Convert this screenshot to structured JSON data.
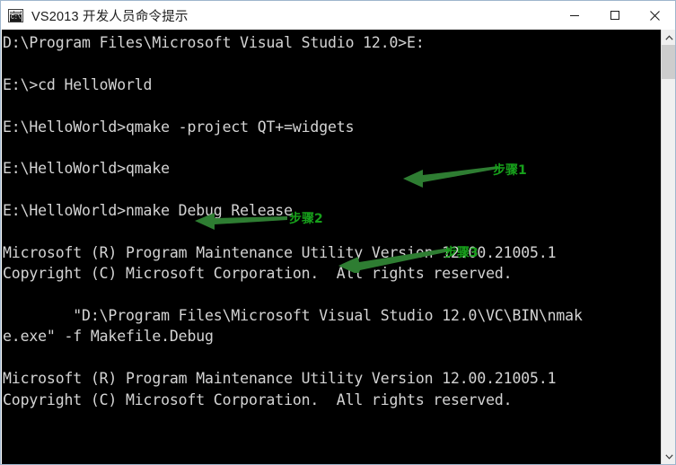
{
  "window": {
    "title": "VS2013 开发人员命令提示",
    "icon": "console-window-icon",
    "icon_glyph": "C:\\.",
    "minimize_label": "最小化",
    "maximize_label": "最大化",
    "close_label": "关闭",
    "background_color": "#000000",
    "foreground_color": "#d4d4d4",
    "titlebar_color": "#ffffff"
  },
  "console": {
    "lines": [
      "D:\\Program Files\\Microsoft Visual Studio 12.0>E:",
      "",
      "E:\\>cd HelloWorld",
      "",
      "E:\\HelloWorld>qmake -project QT+=widgets",
      "",
      "E:\\HelloWorld>qmake",
      "",
      "E:\\HelloWorld>nmake Debug Release",
      "",
      "Microsoft (R) Program Maintenance Utility Version 12.00.21005.1",
      "Copyright (C) Microsoft Corporation.  All rights reserved.",
      "",
      "        \"D:\\Program Files\\Microsoft Visual Studio 12.0\\VC\\BIN\\nmak",
      "e.exe\" -f Makefile.Debug",
      "",
      "Microsoft (R) Program Maintenance Utility Version 12.00.21005.1",
      "Copyright (C) Microsoft Corporation.  All rights reserved.",
      ""
    ]
  },
  "annotations": {
    "color": "#17a01b",
    "items": [
      {
        "label": "步骤1",
        "target_command": "qmake -project QT+=widgets"
      },
      {
        "label": "步骤2",
        "target_command": "qmake"
      },
      {
        "label": "步骤3",
        "target_command": "nmake Debug Release"
      }
    ]
  },
  "scrollbar": {
    "up_label": "向上滚动",
    "down_label": "向下滚动",
    "thumb_label": "滚动条滑块"
  }
}
